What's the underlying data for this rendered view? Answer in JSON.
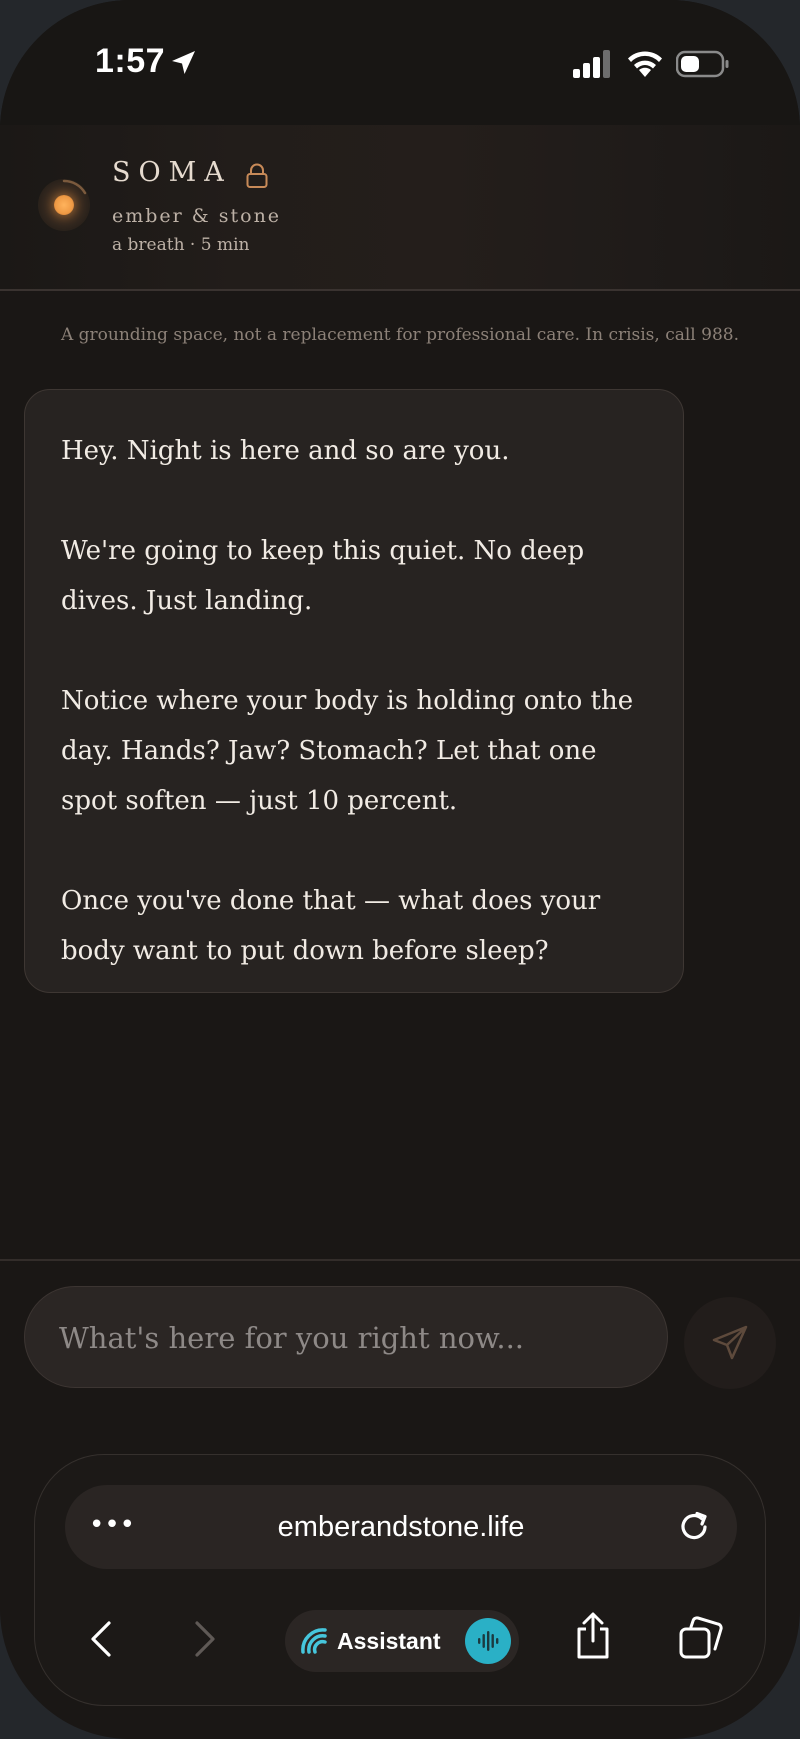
{
  "status_bar": {
    "time": "1:57"
  },
  "header": {
    "brand": "SOMA",
    "subtitle": "ember & stone",
    "session": "a breath · 5 min"
  },
  "disclaimer": "A grounding space, not a replacement for professional care. In crisis, call 988.",
  "message": {
    "paragraphs": [
      "Hey. Night is here and so are you.",
      "We're going to keep this quiet. No deep dives. Just landing.",
      "Notice where your body is holding onto the day. Hands? Jaw? Stomach? Let that one spot soften — just 10 percent.",
      "Once you've done that — what does your body want to put down before sleep?"
    ]
  },
  "composer": {
    "placeholder": "What's here for you right now..."
  },
  "browser": {
    "url": "emberandstone.life",
    "assistant_label": "Assistant"
  },
  "colors": {
    "accent": "#ef9a45",
    "assistant": "#2ab0c6"
  },
  "icons": [
    "location-arrow-icon",
    "signal-icon",
    "wifi-icon",
    "battery-icon",
    "lock-icon",
    "send-icon",
    "more-icon",
    "reload-icon",
    "back-icon",
    "forward-icon",
    "assistant-icon",
    "voice-icon",
    "share-icon",
    "tabs-icon"
  ]
}
